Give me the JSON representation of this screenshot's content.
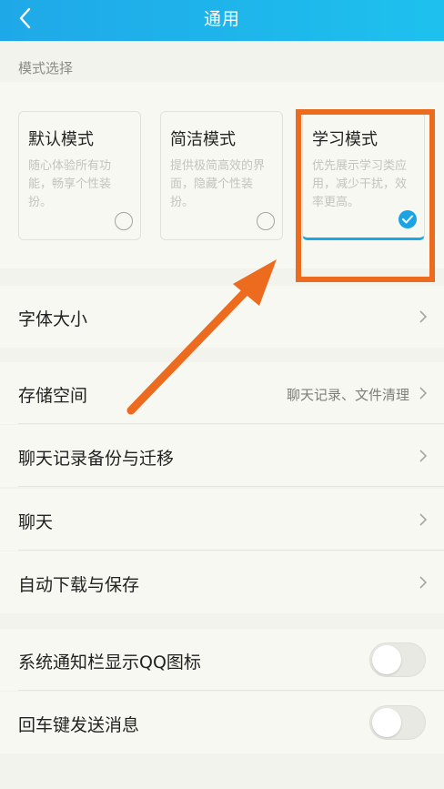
{
  "header": {
    "title": "通用"
  },
  "mode_section": {
    "label": "模式选择",
    "modes": [
      {
        "title": "默认模式",
        "desc": "随心体验所有功能，畅享个性装扮。",
        "selected": false
      },
      {
        "title": "简洁模式",
        "desc": "提供极简高效的界面，隐藏个性装扮。",
        "selected": false
      },
      {
        "title": "学习模式",
        "desc": "优先展示学习类应用，减少干扰，效率更高。",
        "selected": true
      }
    ]
  },
  "rows": {
    "font_size": "字体大小",
    "storage": {
      "label": "存储空间",
      "value": "聊天记录、文件清理"
    },
    "backup": "聊天记录备份与迁移",
    "chat": "聊天",
    "auto_download": "自动下载与保存",
    "notify_icon": {
      "label": "系统通知栏显示QQ图标",
      "on": false
    },
    "enter_send": {
      "label": "回车键发送消息",
      "on": false
    }
  },
  "colors": {
    "header": "#1fa8e8",
    "accent": "#1ca3e4",
    "highlight": "#ec6b1f",
    "background": "#f3f3ed"
  }
}
